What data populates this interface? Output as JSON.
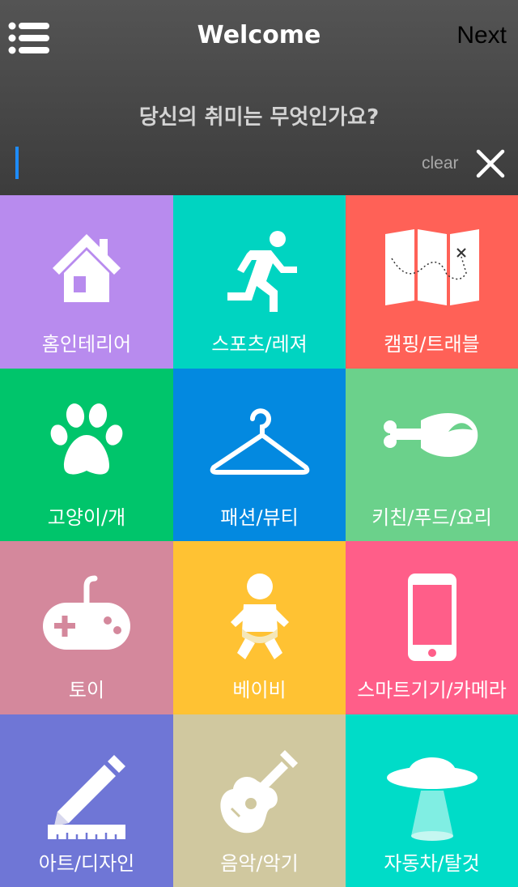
{
  "header": {
    "title": "Welcome",
    "next_label": "Next",
    "question": "당신의 취미는 무엇인가요?",
    "search_value": "",
    "clear_label": "clear",
    "menu_icon": "hamburger-list-icon",
    "close_icon": "close-x-icon"
  },
  "categories": [
    {
      "label": "홈인테리어",
      "icon": "house-icon",
      "color": "#b88bee"
    },
    {
      "label": "스포츠/레져",
      "icon": "running-man-icon",
      "color": "#00d4c1"
    },
    {
      "label": "캠핑/트래블",
      "icon": "map-icon",
      "color": "#ff6157"
    },
    {
      "label": "고양이/개",
      "icon": "paw-icon",
      "color": "#00c56b"
    },
    {
      "label": "패션/뷰티",
      "icon": "hanger-icon",
      "color": "#0389e0"
    },
    {
      "label": "키친/푸드/요리",
      "icon": "drumstick-icon",
      "color": "#6bd18b"
    },
    {
      "label": "토이",
      "icon": "gamepad-icon",
      "color": "#d4889c"
    },
    {
      "label": "베이비",
      "icon": "baby-icon",
      "color": "#ffc233"
    },
    {
      "label": "스마트기기/카메라",
      "icon": "smartphone-icon",
      "color": "#ff5e89"
    },
    {
      "label": "아트/디자인",
      "icon": "pencil-ruler-icon",
      "color": "#6f76d6"
    },
    {
      "label": "음악/악기",
      "icon": "guitar-icon",
      "color": "#d0c89f"
    },
    {
      "label": "자동차/탈것",
      "icon": "ufo-icon",
      "color": "#00dcc8"
    }
  ]
}
